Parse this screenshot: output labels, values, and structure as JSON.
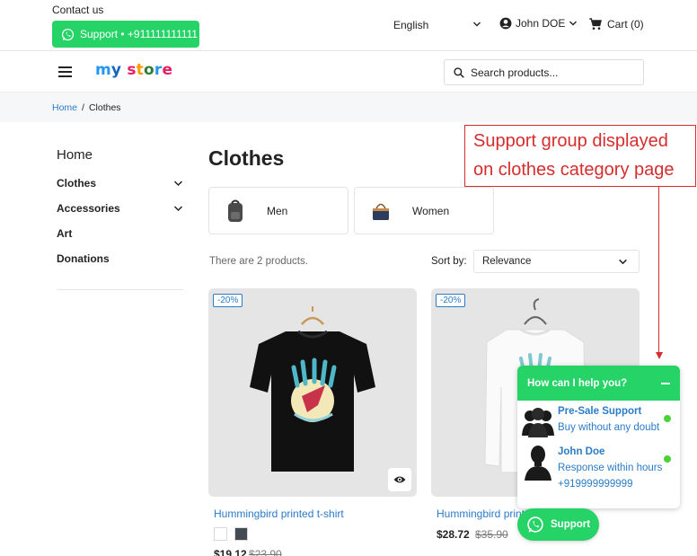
{
  "topbar": {
    "contact_label": "Contact us",
    "whatsapp_button": "Support • +911111111111",
    "language": "English",
    "user_name": "John DOE",
    "cart_label": "Cart (0)"
  },
  "header": {
    "logo": "my store",
    "search_placeholder": "Search products..."
  },
  "breadcrumb": {
    "home": "Home",
    "separator": "/",
    "current": "Clothes"
  },
  "sidebar": {
    "title": "Home",
    "items": [
      {
        "label": "Clothes",
        "expandable": true
      },
      {
        "label": "Accessories",
        "expandable": true
      },
      {
        "label": "Art",
        "expandable": false
      },
      {
        "label": "Donations",
        "expandable": false
      }
    ]
  },
  "category": {
    "title": "Clothes",
    "subcategories": [
      {
        "label": "Men",
        "icon": "backpack-thumbnail"
      },
      {
        "label": "Women",
        "icon": "handbag-thumbnail"
      }
    ],
    "product_count": "There are 2 products.",
    "sort_label": "Sort by:",
    "sort_value": "Relevance"
  },
  "products": [
    {
      "badge": "-20%",
      "name": "Hummingbird printed t-shirt",
      "price": "$19.12",
      "old_price": "$23.90",
      "swatches": [
        "#ffffff",
        "#434a54"
      ]
    },
    {
      "badge": "-20%",
      "name": "Hummingbird printed sweater",
      "price": "$28.72",
      "old_price": "$35.90"
    }
  ],
  "annotation": {
    "line1": "Support group displayed",
    "line2": "on clothes category page"
  },
  "support_widget": {
    "header": "How can I help you?",
    "agents": [
      {
        "name": "Pre-Sale Support",
        "info": "Buy without any doubt",
        "status": "online"
      },
      {
        "name": "John Doe",
        "info": "Response within hours",
        "phone": "+919999999999",
        "status": "online"
      }
    ],
    "button_label": "Support"
  },
  "colors": {
    "whatsapp_green": "#25d366",
    "link_blue": "#2b7bc7",
    "annotation_red": "#d62d2d",
    "online_green": "#4cd137"
  }
}
